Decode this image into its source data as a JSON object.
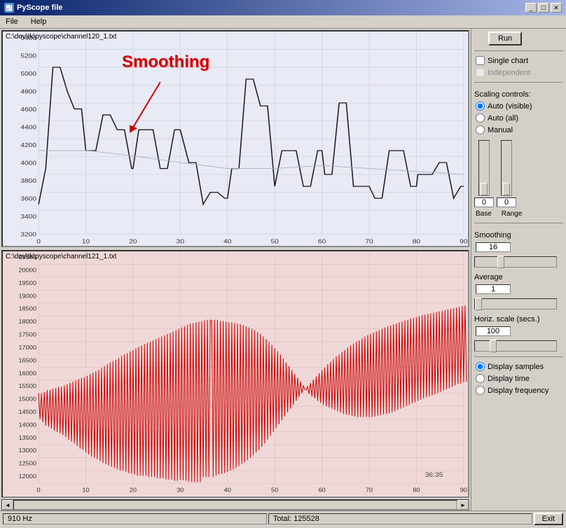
{
  "window": {
    "title": "PyScope file",
    "title_icon": "📈"
  },
  "titleButtons": {
    "minimize": "_",
    "maximize": "□",
    "close": "✕"
  },
  "menu": {
    "items": [
      "File",
      "Help"
    ]
  },
  "sidebar": {
    "run_label": "Run",
    "single_chart_label": "Single chart",
    "independent_label": "Independent",
    "scaling_label": "Scaling controls:",
    "auto_visible_label": "Auto (visible)",
    "auto_all_label": "Auto (all)",
    "manual_label": "Manual",
    "base_label": "Base",
    "range_label": "Range",
    "base_value": "0",
    "range_value": "0",
    "smoothing_label": "Smoothing",
    "smoothing_value": "16",
    "average_label": "Average",
    "average_value": "1",
    "horiz_label": "Horiz. scale (secs.)",
    "horiz_value": "100",
    "display_samples_label": "Display samples",
    "display_time_label": "Display time",
    "display_frequency_label": "Display frequency"
  },
  "charts": {
    "chart1_file": "C:\\dev\\tk\\pyscope\\channel120_1.txt",
    "chart2_file": "C:\\dev\\tk\\pyscope\\channel121_1.txt",
    "smoothing_annotation": "Smoothing",
    "timestamp": "36:35"
  },
  "statusbar": {
    "hz": "910 Hz",
    "total": "Total: 125528",
    "exit": "Exit"
  },
  "chart1": {
    "ymin": 3200,
    "ymax": 5400,
    "xmax": 90,
    "yticks": [
      "5400",
      "5200",
      "5000",
      "4800",
      "4600",
      "4400",
      "4200",
      "4000",
      "3800",
      "3600",
      "3400",
      "3200"
    ],
    "xticks": [
      "0",
      "10",
      "20",
      "30",
      "40",
      "50",
      "60",
      "70",
      "80",
      "90"
    ]
  },
  "chart2": {
    "ymin": 12000,
    "ymax": 20500,
    "yticks": [
      "20500",
      "20000",
      "19500",
      "19000",
      "18500",
      "18000",
      "17500",
      "17000",
      "16500",
      "16000",
      "15500",
      "15000",
      "14500",
      "14000",
      "13500",
      "13000",
      "12500",
      "12000"
    ],
    "xticks": [
      "0",
      "10",
      "20",
      "30",
      "40",
      "50",
      "60",
      "70",
      "80",
      "90"
    ]
  }
}
